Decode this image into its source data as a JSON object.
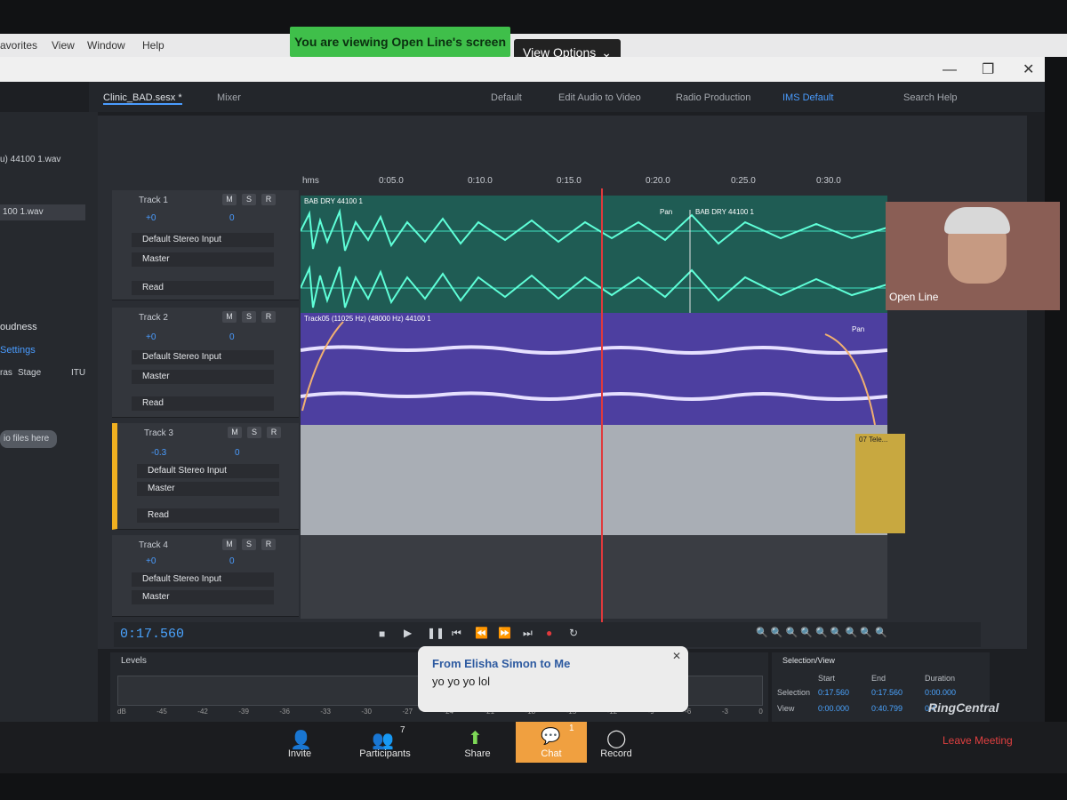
{
  "menu": {
    "favorites": "avorites",
    "view": "View",
    "window": "Window",
    "help": "Help"
  },
  "share": {
    "banner": "You are viewing Open Line's screen",
    "view_options": "View Options"
  },
  "workspace": {
    "file_tab": "Clinic_BAD.sesx *",
    "mixer_tab": "Mixer",
    "default": "Default",
    "edit_audio": "Edit Audio to Video",
    "radio": "Radio Production",
    "ims": "IMS Default",
    "search": "Search Help"
  },
  "left": {
    "file1": "u) 44100 1.wav",
    "file2": "100 1.wav",
    "loudness": "oudness",
    "settings": "Settings",
    "ras": "ras",
    "stage": "Stage",
    "itu": "ITU",
    "drop": "io files here"
  },
  "ruler": {
    "hms": "hms",
    "t1": "0:05.0",
    "t2": "0:10.0",
    "t3": "0:15.0",
    "t4": "0:20.0",
    "t5": "0:25.0",
    "t6": "0:30.0"
  },
  "tracks": [
    {
      "name": "Track 1",
      "vol": "+0",
      "pan": "0",
      "input": "Default Stereo Input",
      "output": "Master",
      "mode": "Read",
      "clip": "BAB DRY 44100 1",
      "clip2": "BAB DRY 44100 1",
      "pan_label": "Pan"
    },
    {
      "name": "Track 2",
      "vol": "+0",
      "pan": "0",
      "input": "Default Stereo Input",
      "output": "Master",
      "mode": "Read",
      "clip": "Track05 (11025 Hz) (48000 Hz) 44100 1",
      "pan_label": "Pan"
    },
    {
      "name": "Track 3",
      "vol": "-0.3",
      "pan": "0",
      "input": "Default Stereo Input",
      "output": "Master",
      "mode": "Read",
      "clip": "07 Tele..."
    },
    {
      "name": "Track 4",
      "vol": "+0",
      "pan": "0",
      "input": "Default Stereo Input",
      "output": "Master"
    }
  ],
  "msr": {
    "m": "M",
    "s": "S",
    "r": "R"
  },
  "transport": {
    "time": "0:17.560"
  },
  "levels": {
    "title": "Levels",
    "scale": [
      "dB",
      "-45",
      "-42",
      "-39",
      "-36",
      "-33",
      "-30",
      "-27",
      "-24",
      "-21",
      "-18",
      "-15",
      "-12",
      "-9",
      "-6",
      "-3",
      "0"
    ]
  },
  "selection": {
    "title": "Selection/View",
    "start": "Start",
    "end": "End",
    "duration": "Duration",
    "sel_label": "Selection",
    "sel_start": "0:17.560",
    "sel_end": "0:17.560",
    "sel_dur": "0:00.000",
    "view_label": "View",
    "view_start": "0:00.000",
    "view_end": "0:40.799",
    "view_dur": "0:4"
  },
  "chat_popup": {
    "from": "From Elisha Simon to Me",
    "message": "yo yo yo lol"
  },
  "webcam": {
    "name": "Open Line"
  },
  "bottom": {
    "invite": "Invite",
    "participants": "Participants",
    "participants_count": "7",
    "share": "Share",
    "chat": "Chat",
    "chat_count": "1",
    "record": "Record",
    "leave": "Leave Meeting",
    "brand": "RingCentral"
  },
  "colors": {
    "track1": "#2f8c7a",
    "track2": "#5a47a8",
    "track3": "#9aa0a8",
    "accent": "#4aa4ff",
    "record": "#e0393c"
  }
}
